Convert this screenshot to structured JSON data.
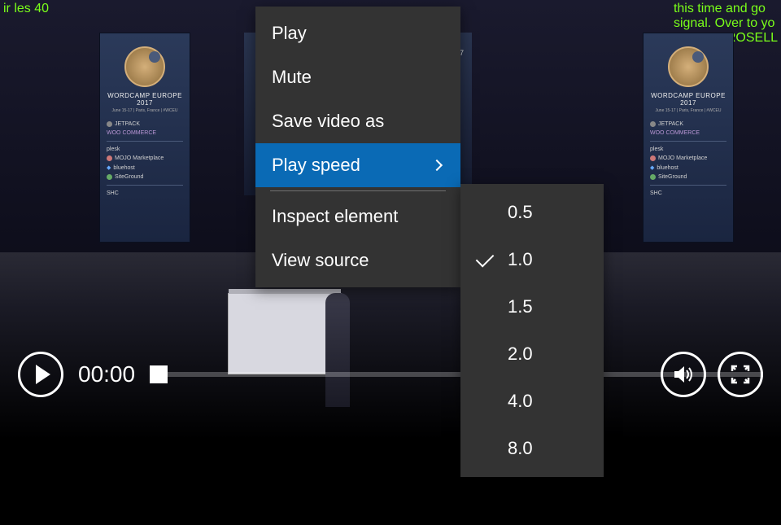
{
  "captions": {
    "left": "ir les 40",
    "right": "this time and go\nsignal. Over to yo\nADRIAN ROSELL"
  },
  "banner": {
    "title": "WORDCAMP EUROPE 2017",
    "subtitle": "June 15-17 | Paris, France | #WCEU",
    "sponsors": {
      "jetpack": "JETPACK",
      "woo": "WOO COMMERCE",
      "plesk": "plesk",
      "mojo": "MOJO Marketplace",
      "bluehost": "bluehost",
      "siteground": "SiteGround",
      "bottom1": "SHC",
      "bottom2": ""
    }
  },
  "screen_text": "2017",
  "player": {
    "time": "00:00"
  },
  "context_menu": {
    "items": [
      {
        "label": "Play"
      },
      {
        "label": "Mute"
      },
      {
        "label": "Save video as"
      },
      {
        "label": "Play speed",
        "has_submenu": true,
        "highlighted": true
      }
    ],
    "items_after_divider": [
      {
        "label": "Inspect element"
      },
      {
        "label": "View source"
      }
    ]
  },
  "submenu": {
    "items": [
      {
        "label": "0.5",
        "selected": false
      },
      {
        "label": "1.0",
        "selected": true
      },
      {
        "label": "1.5",
        "selected": false
      },
      {
        "label": "2.0",
        "selected": false
      },
      {
        "label": "4.0",
        "selected": false
      },
      {
        "label": "8.0",
        "selected": false
      }
    ]
  }
}
